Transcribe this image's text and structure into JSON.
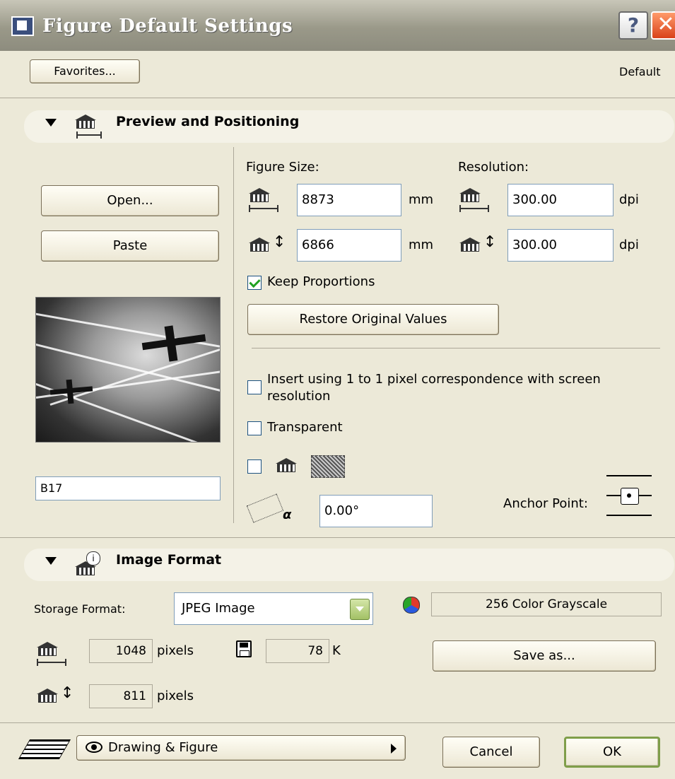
{
  "window": {
    "title": "Figure Default Settings",
    "help_label": "?",
    "close_label": "✕"
  },
  "header": {
    "favorites_label": "Favorites...",
    "default_label": "Default"
  },
  "preview_section": {
    "title": "Preview and Positioning",
    "open_label": "Open...",
    "paste_label": "Paste",
    "figure_size_label": "Figure Size:",
    "resolution_label": "Resolution:",
    "width_value": "8873",
    "height_value": "6866",
    "size_unit": "mm",
    "res_h_value": "300.00",
    "res_v_value": "300.00",
    "res_unit": "dpi",
    "keep_proportions_label": "Keep Proportions",
    "keep_proportions_checked": true,
    "restore_label": "Restore Original Values",
    "pixel_correspondence_label": "Insert using 1 to 1 pixel correspondence with screen resolution",
    "transparent_label": "Transparent",
    "angle_value": "0.00°",
    "anchor_label": "Anchor Point:",
    "name_value": "B17"
  },
  "image_format_section": {
    "title": "Image Format",
    "storage_format_label": "Storage Format:",
    "storage_format_value": "JPEG Image",
    "color_mode_value": "256 Color Grayscale",
    "width_px": "1048",
    "height_px": "811",
    "pixels_unit": "pixels",
    "file_size": "78",
    "file_size_unit": "K",
    "save_as_label": "Save as..."
  },
  "footer": {
    "layer_menu_label": "Drawing & Figure",
    "cancel_label": "Cancel",
    "ok_label": "OK"
  },
  "icons": [
    "figure-icon",
    "help-icon",
    "close-icon",
    "collapse-triangle-icon",
    "width-icon",
    "height-icon",
    "angle-icon",
    "anchor-point-icon",
    "color-wheel-icon",
    "floppy-disk-icon",
    "layers-icon",
    "eye-icon",
    "dropdown-arrow-icon",
    "submenu-arrow-icon"
  ],
  "colors": {
    "titlebar": "#9a9989",
    "dialog_bg": "#ece9d8",
    "close_button": "#d9421a",
    "checkbox_check": "#21a121"
  }
}
